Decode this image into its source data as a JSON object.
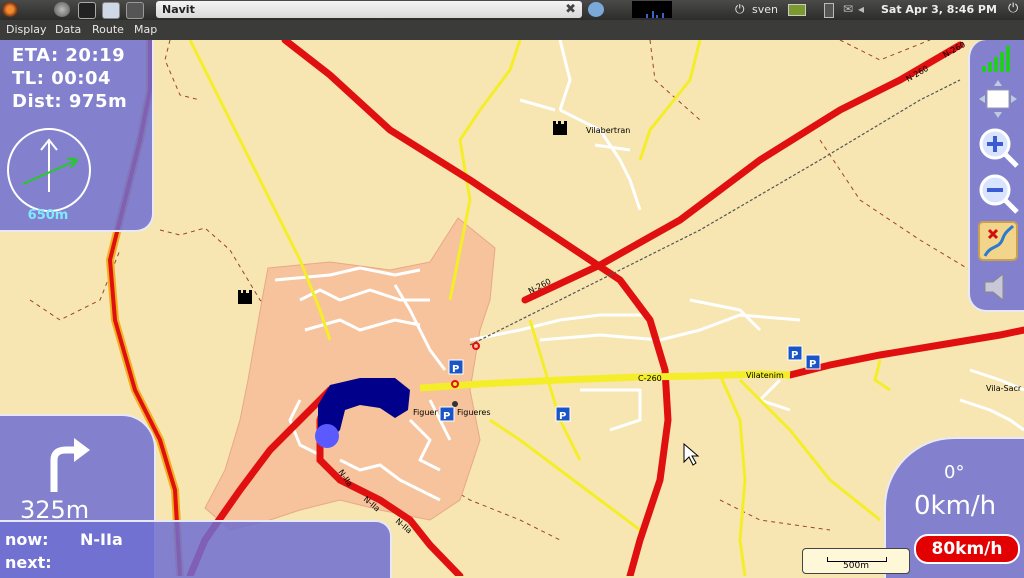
{
  "topbar": {
    "app_title": "Navit",
    "user": "sven",
    "clock": "Sat Apr  3,  8:46 PM",
    "close_glyph": "✖"
  },
  "menu": {
    "display": "Display",
    "data": "Data",
    "route": "Route",
    "map": "Map"
  },
  "nav": {
    "eta": "ETA: 20:19",
    "time_left": "TL:    00:04",
    "distance": "Dist: 975m",
    "compass_distance": "650m",
    "turn_distance": "325m",
    "now_label": "now:",
    "now_street": "N-IIa",
    "next_label": "next:",
    "next_street": "",
    "heading": "0°",
    "speed": "0km/h",
    "speed_limit": "80km/h",
    "scale": "500m"
  },
  "map_labels": {
    "vilabertran": "Vilabertran",
    "figueres": "Figueres",
    "figueres_left": "Figuer",
    "vilatenim": "Vilatenim",
    "vila_sacra": "Vila-Sacr",
    "c260": "C-260",
    "n260_east": "N-260",
    "n260_mid": "N-260",
    "n260_top": "N-260",
    "c260_east": "C-260",
    "n2a_1": "N-IIa",
    "n2a_2": "N-IIa",
    "n2a_3": "N-IIa",
    "parking": "P"
  },
  "colors": {
    "map_background": "#f7e6b1",
    "urban_area": "#f6c39c",
    "motorway": "#e01010",
    "main_road": "#f4ee2a",
    "route": "#00008b",
    "panel": "#6e6ed2"
  },
  "icons": {
    "app": "app-icon",
    "globe": "globe-icon",
    "terminal": "terminal-icon",
    "files": "files-icon",
    "zoom_in": "zoom-in-icon",
    "zoom_out": "zoom-out-icon",
    "map": "map-icon",
    "speaker": "speaker-icon",
    "signal": "gps-signal-icon",
    "castle": "castle-icon",
    "parking": "parking-icon",
    "cursor": "mouse-cursor-icon"
  }
}
